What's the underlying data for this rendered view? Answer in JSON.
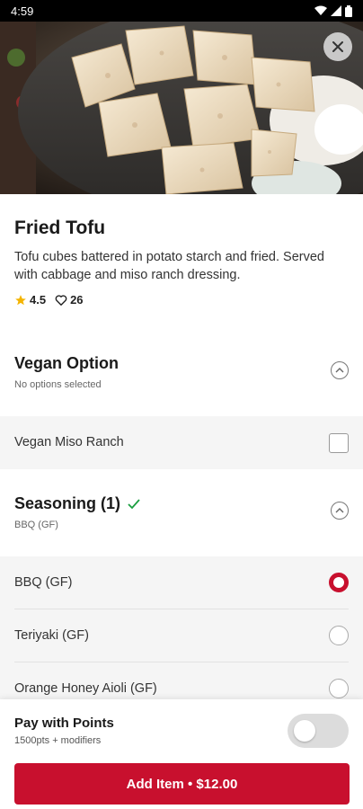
{
  "status_bar": {
    "time": "4:59"
  },
  "item": {
    "title": "Fried Tofu",
    "description": "Tofu cubes battered in potato starch and fried. Served with cabbage and miso ranch dressing.",
    "rating": "4.5",
    "likes": "26"
  },
  "groups": [
    {
      "title": "Vegan Option",
      "subtitle": "No options selected",
      "options": [
        {
          "label": "Vegan Miso Ranch",
          "type": "checkbox",
          "checked": false
        }
      ]
    },
    {
      "title": "Seasoning (1)",
      "subtitle": "BBQ (GF)",
      "completed": true,
      "options": [
        {
          "label": "BBQ (GF)",
          "type": "radio",
          "selected": true
        },
        {
          "label": "Teriyaki (GF)",
          "type": "radio",
          "selected": false
        },
        {
          "label": "Orange Honey Aioli (GF)",
          "type": "radio",
          "selected": false
        }
      ]
    }
  ],
  "bottom": {
    "points_title": "Pay with Points",
    "points_sub": "1500pts + modifiers",
    "toggle_on": false,
    "add_label": "Add Item • $12.00"
  },
  "colors": {
    "accent": "#c8102e",
    "check": "#1a9e3f"
  }
}
